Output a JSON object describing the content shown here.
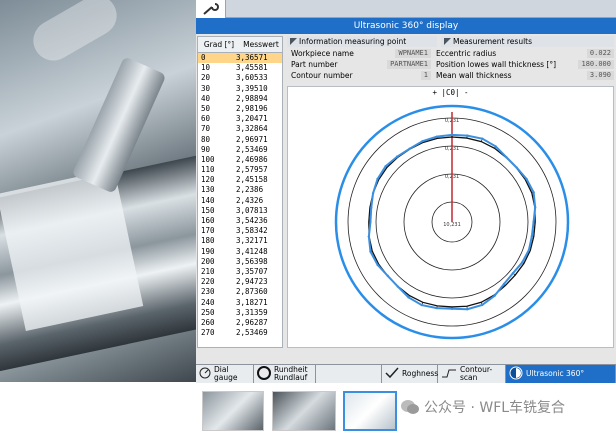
{
  "app": {
    "title": "Ultrasonic 360° display",
    "zoom_label": "+ |C0| -"
  },
  "table": {
    "headers": [
      "Grad [°]",
      "Messwert"
    ],
    "rows": [
      [
        "0",
        "3,36571"
      ],
      [
        "10",
        "3,45581"
      ],
      [
        "20",
        "3,60533"
      ],
      [
        "30",
        "3,39510"
      ],
      [
        "40",
        "2,98894"
      ],
      [
        "50",
        "2,98196"
      ],
      [
        "60",
        "3,20471"
      ],
      [
        "70",
        "3,32864"
      ],
      [
        "80",
        "2,96971"
      ],
      [
        "90",
        "2,53469"
      ],
      [
        "100",
        "2,46986"
      ],
      [
        "110",
        "2,57957"
      ],
      [
        "120",
        "2,45158"
      ],
      [
        "130",
        "2,2386"
      ],
      [
        "140",
        "2,4326"
      ],
      [
        "150",
        "3,07813"
      ],
      [
        "160",
        "3,54236"
      ],
      [
        "170",
        "3,58342"
      ],
      [
        "180",
        "3,32171"
      ],
      [
        "190",
        "3,41248"
      ],
      [
        "200",
        "3,56398"
      ],
      [
        "210",
        "3,35707"
      ],
      [
        "220",
        "2,94723"
      ],
      [
        "230",
        "2,87360"
      ],
      [
        "240",
        "3,18271"
      ],
      [
        "250",
        "3,31359"
      ],
      [
        "260",
        "2,96287"
      ],
      [
        "270",
        "2,53469"
      ]
    ]
  },
  "info_panel": {
    "title": "Information measuring point",
    "fields": [
      {
        "label": "Workpiece name",
        "value": "WPNAME1"
      },
      {
        "label": "Part number",
        "value": "PARTNAME1"
      },
      {
        "label": "Contour number",
        "value": "1"
      }
    ]
  },
  "results_panel": {
    "title": "Measurement results",
    "fields": [
      {
        "label": "Eccentric radius",
        "value": "0.022"
      },
      {
        "label": "Position lowes wall thickness [°]",
        "value": "180.000"
      },
      {
        "label": "Mean wall thickness",
        "value": "3.090"
      }
    ]
  },
  "chart_data": {
    "type": "polar-line",
    "ring_labels": [
      "0,231",
      "0,231",
      "0,231",
      "10,231"
    ],
    "series": [
      {
        "values_deg": [
          0,
          10,
          20,
          30,
          40,
          50,
          60,
          70,
          80,
          90,
          100,
          110,
          120,
          130,
          140,
          150,
          160,
          170,
          180,
          190,
          200,
          210,
          220,
          230,
          240,
          250,
          260,
          270,
          280,
          290,
          300,
          310,
          320,
          330,
          340,
          350
        ],
        "values": [
          3.36571,
          3.45581,
          3.60533,
          3.3951,
          2.98894,
          2.98196,
          3.20471,
          3.32864,
          2.96971,
          2.53469,
          2.46986,
          2.57957,
          2.45158,
          2.2386,
          2.4326,
          3.07813,
          3.54236,
          3.58342,
          3.32171,
          3.41248,
          3.56398,
          3.35707,
          2.94723,
          2.8736,
          3.18271,
          3.31359,
          2.96287,
          2.53469,
          2.6,
          2.9,
          3.2,
          3.3,
          3.1,
          3.0,
          3.2,
          3.3
        ]
      }
    ],
    "colors": {
      "measured": "#3b8fe0",
      "reference": "#111111",
      "marker": "#c0282d",
      "outer_ring": "#2a8ee8"
    }
  },
  "softkeys": [
    {
      "label": "Dial gauge",
      "icon": "gauge-icon"
    },
    {
      "label": "Rundheit Rundlauf",
      "icon": "circle-icon"
    },
    {
      "label": "",
      "icon": ""
    },
    {
      "label": "Roghness",
      "icon": "check-icon"
    },
    {
      "label": "Contour-scan",
      "icon": "contour-icon"
    },
    {
      "label": "Ultrasonic 360°",
      "icon": "ultrasonic-icon",
      "active": true
    }
  ],
  "watermark": "公众号 · WFL车铣复合"
}
